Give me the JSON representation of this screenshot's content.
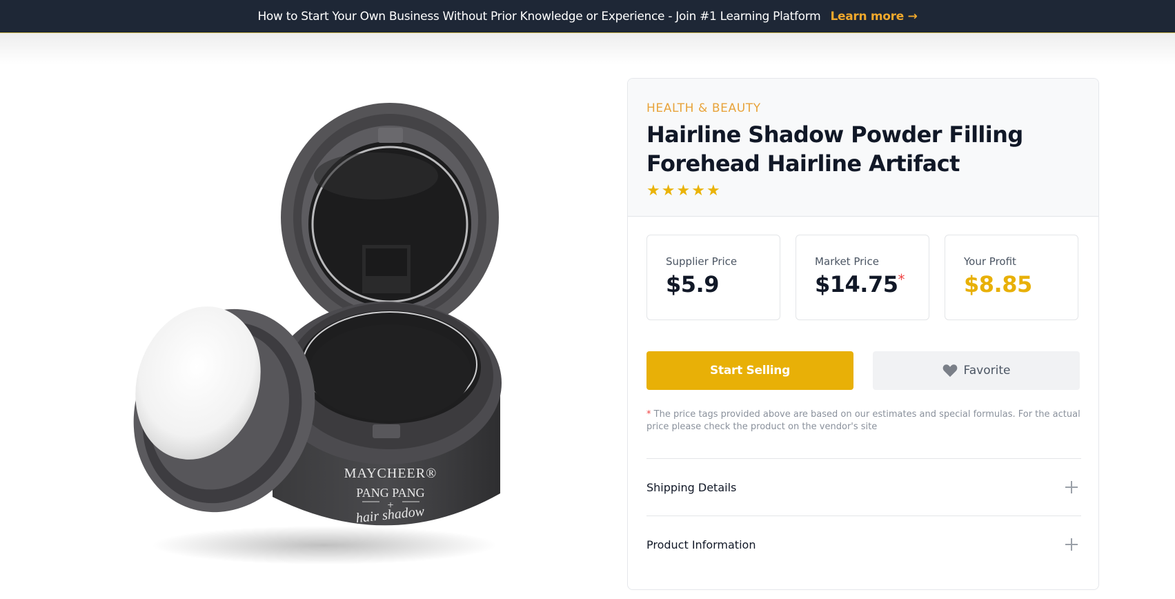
{
  "banner": {
    "text": "How to Start Your Own Business Without Prior Knowledge or Experience - Join #1 Learning Platform",
    "link_label": "Learn more →"
  },
  "product": {
    "image_brand": "MAYCHEER®",
    "image_line1": "PANG PANG",
    "image_line2": "hair shadow",
    "category": "HEALTH & BEAUTY",
    "title": "Hairline Shadow Powder Filling Forehead Hairline Artifact",
    "rating": 5,
    "rating_max": 5
  },
  "prices": {
    "supplier_label": "Supplier Price",
    "supplier_value": "$5.9",
    "market_label": "Market Price",
    "market_value": "$14.75",
    "market_asterisk": "*",
    "profit_label": "Your Profit",
    "profit_value": "$8.85"
  },
  "actions": {
    "sell_label": "Start Selling",
    "favorite_label": "Favorite"
  },
  "note": {
    "asterisk": "*",
    "text": "The price tags provided above are based on our estimates and special formulas. For the actual price please check the product on the vendor's site"
  },
  "accordion": [
    {
      "label": "Shipping Details",
      "icon": "plus-icon"
    },
    {
      "label": "Product Information",
      "icon": "plus-icon"
    }
  ],
  "colors": {
    "banner_bg": "#1e2736",
    "accent": "#e8b007",
    "link": "#f0a82c",
    "category": "#e8a33a"
  }
}
